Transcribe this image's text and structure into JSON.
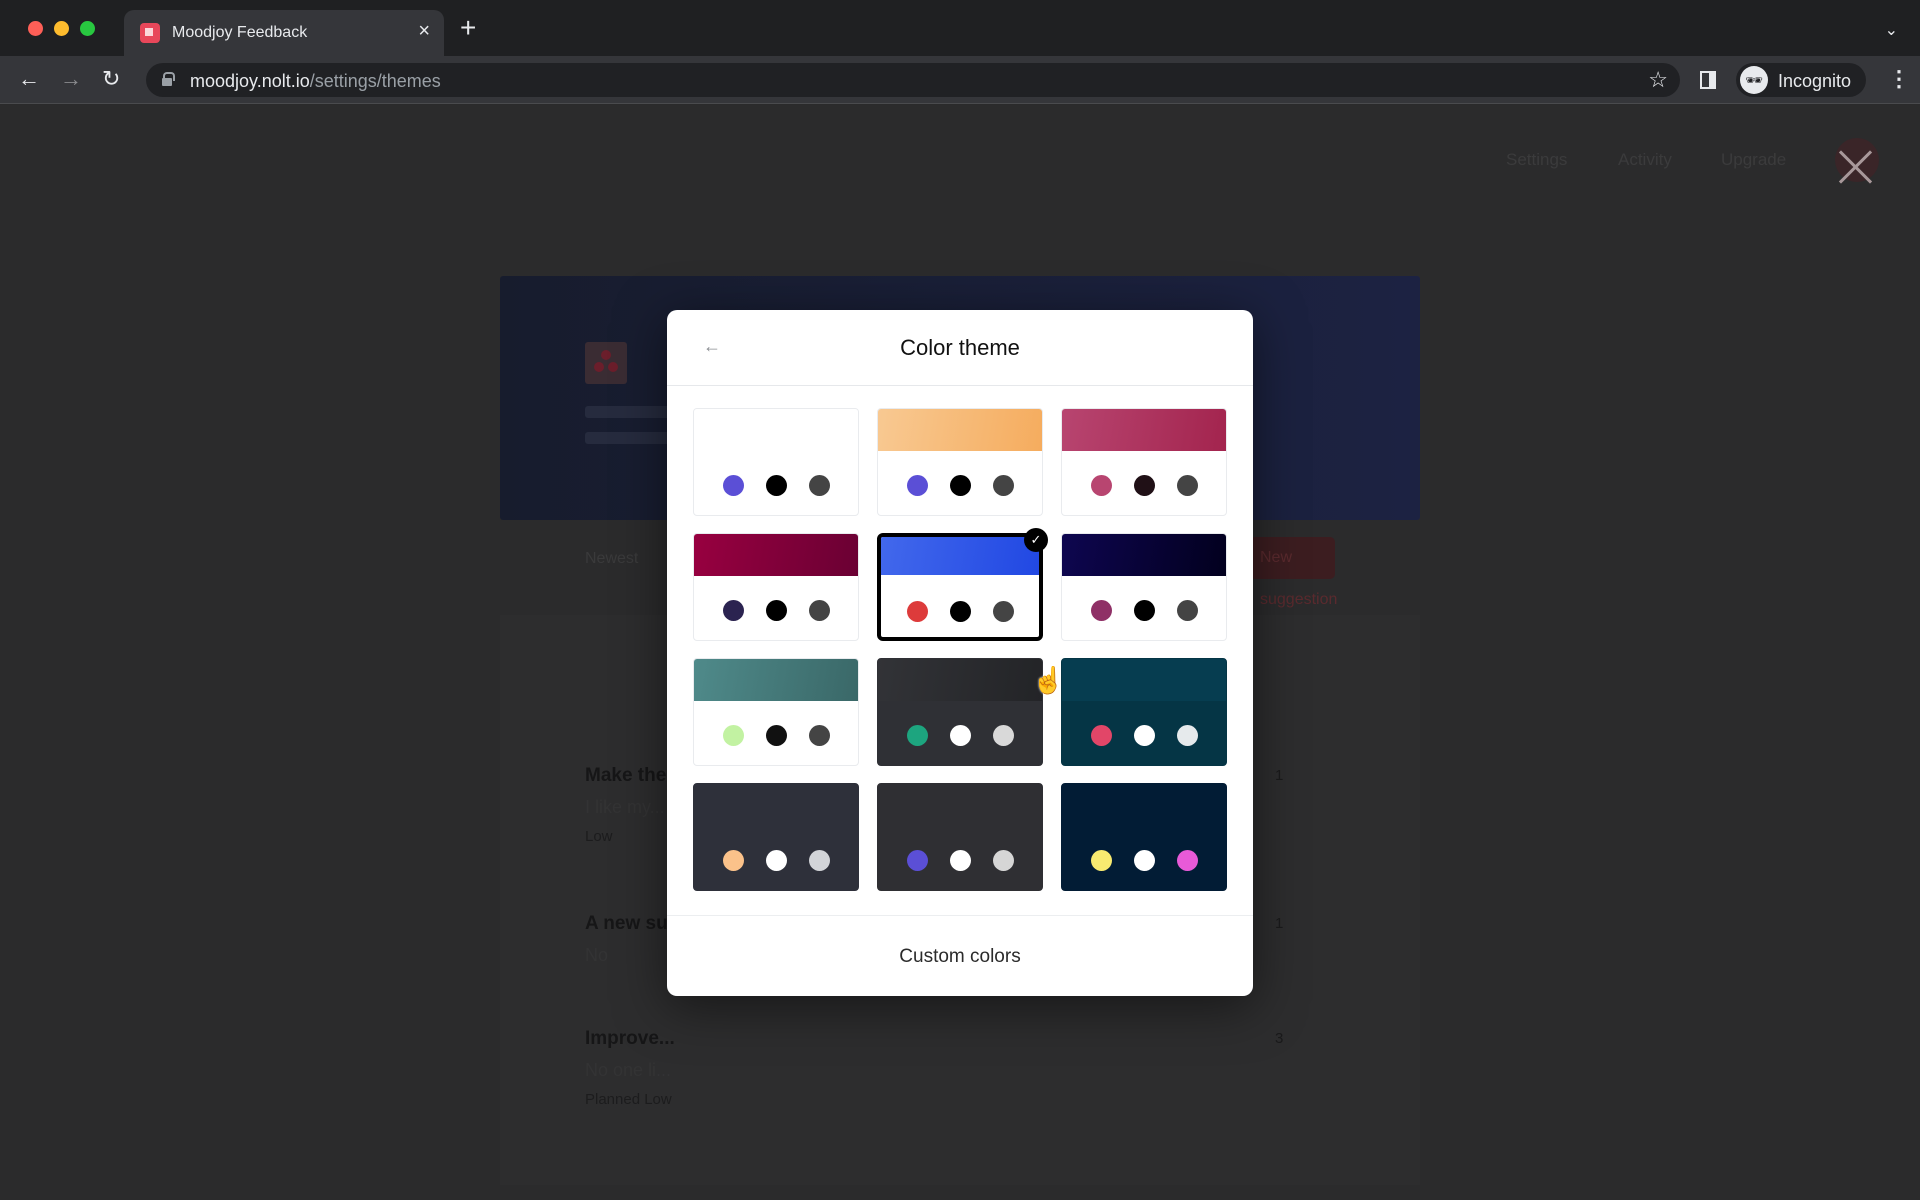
{
  "browser": {
    "tab_title": "Moodjoy Feedback",
    "tab_close": "×",
    "new_tab": "+",
    "url_host": "moodjoy.nolt.io",
    "url_path": "/settings/themes",
    "profile_label": "Incognito",
    "icons": {
      "back": "←",
      "forward": "→",
      "reload": "↻",
      "star": "☆",
      "menu": "⋮",
      "tab_search": "⌄",
      "incognito": "🕶"
    }
  },
  "page": {
    "nav": [
      "Settings",
      "Activity",
      "Upgrade"
    ],
    "filter_label": "Newest",
    "new_button_label": "New suggestion",
    "posts": [
      {
        "title": "Make the...",
        "desc": "I like my...",
        "tags": "Low",
        "votes": "1"
      },
      {
        "title": "A new su...",
        "desc": "No",
        "tags": "",
        "votes": "1"
      },
      {
        "title": "Improve...",
        "desc": "No one li...",
        "tags": "Planned   Low",
        "votes": "3"
      }
    ]
  },
  "modal": {
    "title": "Color theme",
    "back_icon": "←",
    "footer_button": "Custom colors",
    "selected_index": 4,
    "themes": [
      {
        "name": "light",
        "band": "#ffffff",
        "band_end": "#ffffff",
        "body": "#ffffff",
        "dots": [
          "#5b4fd6",
          "#000000",
          "#444444"
        ]
      },
      {
        "name": "peach",
        "band": "#f8c992",
        "band_end": "#f5ac5e",
        "body": "#ffffff",
        "dots": [
          "#5b4fd6",
          "#000000",
          "#444444"
        ]
      },
      {
        "name": "rose",
        "band": "#b84570",
        "band_end": "#a3244e",
        "body": "#ffffff",
        "dots": [
          "#b84570",
          "#201016",
          "#444444"
        ]
      },
      {
        "name": "crimson",
        "band": "#980040",
        "band_end": "#6a0033",
        "body": "#ffffff",
        "dots": [
          "#2b2350",
          "#000000",
          "#444444"
        ]
      },
      {
        "name": "blue",
        "band": "#4268ec",
        "band_end": "#2148e3",
        "body": "#ffffff",
        "dots": [
          "#dd3b3b",
          "#000000",
          "#444444"
        ]
      },
      {
        "name": "midnight",
        "band": "#0e0650",
        "band_end": "#02001e",
        "body": "#ffffff",
        "dots": [
          "#8f3066",
          "#000000",
          "#444444"
        ]
      },
      {
        "name": "teal",
        "band": "#4f8a8a",
        "band_end": "#3a6868",
        "body": "#ffffff",
        "dots": [
          "#c2f2a2",
          "#111111",
          "#444444"
        ]
      },
      {
        "name": "charcoal",
        "band": "#323337",
        "band_end": "#232427",
        "body": "#2f3035",
        "dots": [
          "#1da57f",
          "#ffffff",
          "#d9d9d9"
        ]
      },
      {
        "name": "ocean",
        "band": "#063d50",
        "band_end": "#063d50",
        "body": "#053545",
        "dots": [
          "#e24668",
          "#ffffff",
          "#e6eaec"
        ]
      },
      {
        "name": "slate",
        "band": "#2e303a",
        "band_end": "#2e303a",
        "body": "#2e303a",
        "dots": [
          "#fbc28a",
          "#ffffff",
          "#d2d4d8"
        ]
      },
      {
        "name": "graphite",
        "band": "#2f2f33",
        "band_end": "#2f2f33",
        "body": "#2f2f33",
        "dots": [
          "#5b4fd6",
          "#ffffff",
          "#d6d6d6"
        ]
      },
      {
        "name": "navy",
        "band": "#021c35",
        "band_end": "#021c35",
        "body": "#021c35",
        "dots": [
          "#f8ea70",
          "#ffffff",
          "#e85ad8"
        ]
      }
    ],
    "check_icon": "✓"
  }
}
